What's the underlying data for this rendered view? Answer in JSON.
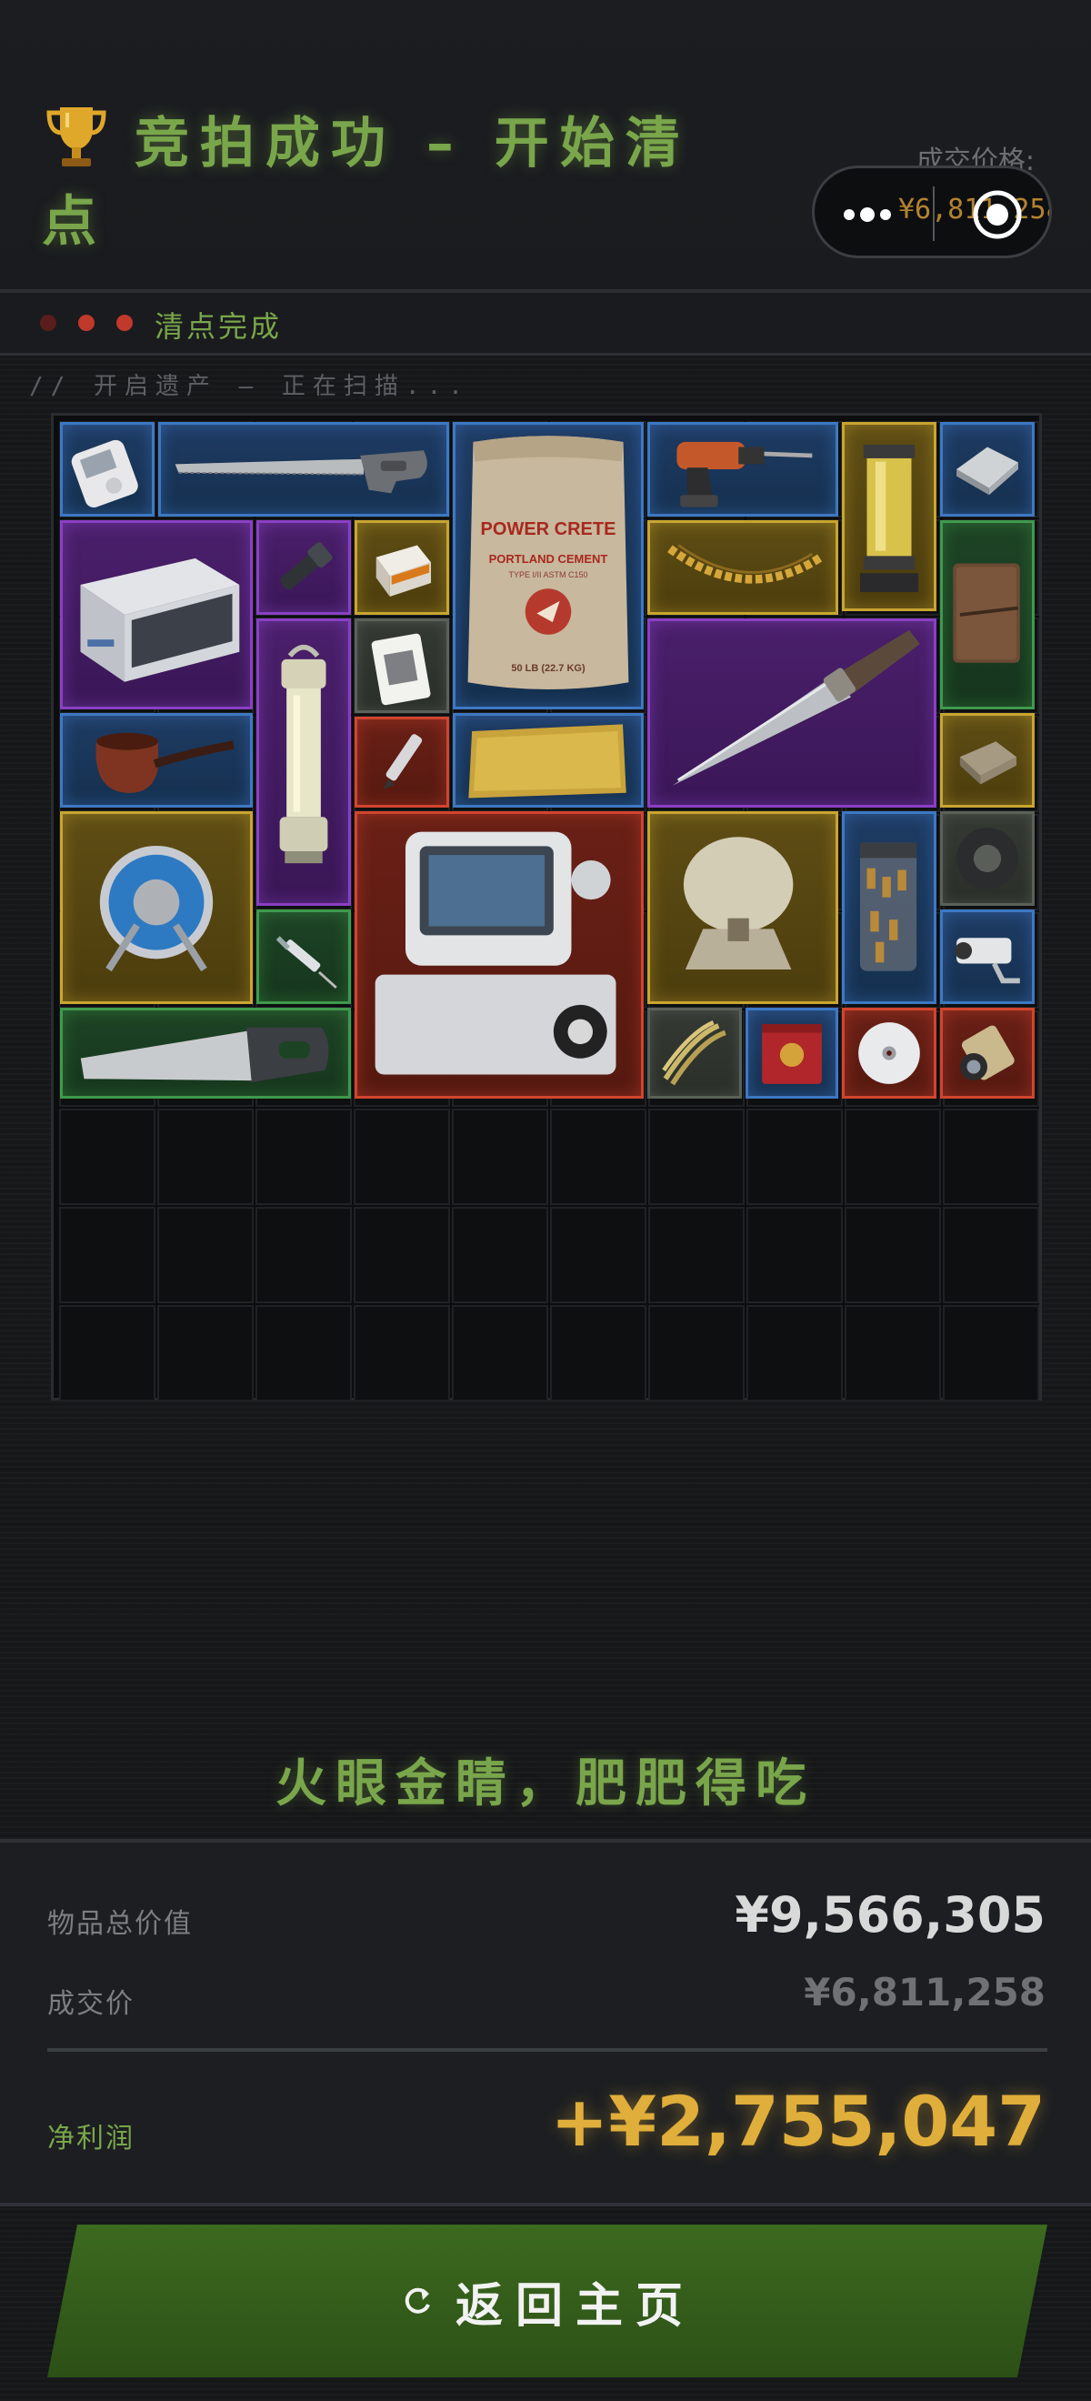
{
  "header": {
    "title": "竞拍成功 – 开始清点",
    "price_label": "成交价格:",
    "price_value": "¥6,811,258"
  },
  "status": {
    "text": "清点完成",
    "dot_colors": [
      "#5a1d1d",
      "#c0392b",
      "#c0392b"
    ]
  },
  "scan_text": "// 开启遗产 – 正在扫描...",
  "slogan": "火眼金睛，肥肥得吃",
  "summary": {
    "total_label": "物品总价值",
    "total_value": "¥9,566,305",
    "deal_label": "成交价",
    "deal_value": "¥6,811,258",
    "profit_label": "净利润",
    "profit_value": "+¥2,755,047"
  },
  "button": {
    "label": "返回主页",
    "icon": "refresh-icon"
  },
  "colors": {
    "accent_green": "#79a64a",
    "profit_gold": "#e0ae3a",
    "rarity_blue": "#3d78c4",
    "rarity_purple": "#8a3fc4",
    "rarity_gold": "#c9a530",
    "rarity_green": "#3f9a4c",
    "rarity_red": "#d2442e",
    "rarity_gray": "#5a6158"
  },
  "cement_bag": {
    "brand": "POWER CRETE",
    "product": "PORTLAND CEMENT",
    "type": "TYPE I/II ASTM C150",
    "weight": "50 LB (22.7 KG)"
  },
  "items": [
    {
      "name": "mp3-player",
      "rarity": "blue"
    },
    {
      "name": "hand-saw",
      "rarity": "blue"
    },
    {
      "name": "cement-bag",
      "rarity": "blue"
    },
    {
      "name": "power-drill",
      "rarity": "blue"
    },
    {
      "name": "fuel-canister",
      "rarity": "gold"
    },
    {
      "name": "metal-plate",
      "rarity": "blue"
    },
    {
      "name": "incubator",
      "rarity": "purple"
    },
    {
      "name": "flashlight",
      "rarity": "purple"
    },
    {
      "name": "cigarette-pack",
      "rarity": "gold"
    },
    {
      "name": "gold-chain",
      "rarity": "gold"
    },
    {
      "name": "leather-journal",
      "rarity": "green"
    },
    {
      "name": "lantern",
      "rarity": "purple"
    },
    {
      "name": "playing-card",
      "rarity": "gray"
    },
    {
      "name": "combat-knife",
      "rarity": "purple"
    },
    {
      "name": "tobacco-pipe",
      "rarity": "blue"
    },
    {
      "name": "fountain-pen",
      "rarity": "red"
    },
    {
      "name": "gold-bar",
      "rarity": "blue"
    },
    {
      "name": "circuit-board",
      "rarity": "gold"
    },
    {
      "name": "cable-reel",
      "rarity": "gold"
    },
    {
      "name": "medical-monitor",
      "rarity": "red"
    },
    {
      "name": "satellite-dish",
      "rarity": "gold"
    },
    {
      "name": "ammo-jar",
      "rarity": "blue"
    },
    {
      "name": "duct-tape",
      "rarity": "gray"
    },
    {
      "name": "syringe",
      "rarity": "green"
    },
    {
      "name": "security-camera",
      "rarity": "blue"
    },
    {
      "name": "panel-saw",
      "rarity": "green"
    },
    {
      "name": "rope-bundle",
      "rarity": "gray"
    },
    {
      "name": "tea-tin",
      "rarity": "blue"
    },
    {
      "name": "compact-disc",
      "rarity": "red"
    },
    {
      "name": "camera-lens",
      "rarity": "red"
    }
  ]
}
